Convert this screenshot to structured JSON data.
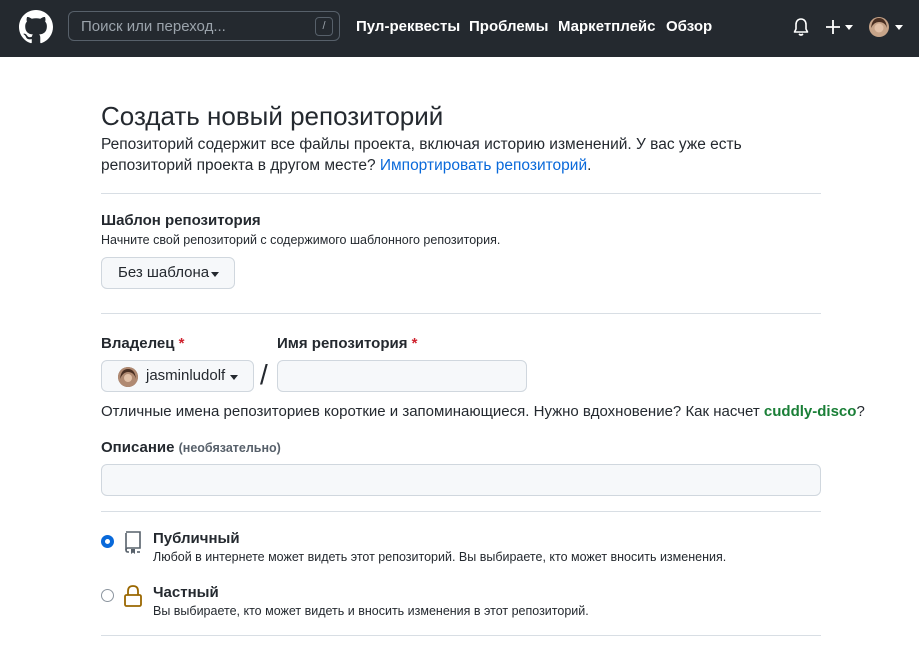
{
  "header": {
    "search_placeholder": "Поиск или переход...",
    "search_shortcut": "/",
    "nav": {
      "pulls": "Пул-реквесты",
      "issues": "Проблемы",
      "marketplace": "Маркетплейс",
      "explore": "Обзор"
    },
    "icons": [
      "github-logo-icon",
      "bell-icon",
      "plus-icon",
      "avatar"
    ]
  },
  "page": {
    "title": "Создать новый репозиторий",
    "lead_text": "Репозиторий содержит все файлы проекта, включая историю изменений. У вас уже есть репозиторий проекта в другом месте? ",
    "import_link": "Импортировать репозиторий",
    "lead_end": "."
  },
  "template": {
    "label": "Шаблон репозитория",
    "note": "Начните свой репозиторий с содержимого шаблонного репозитория.",
    "button": "Без шаблона"
  },
  "owner": {
    "label": "Владелец",
    "required_mark": "*",
    "value": "jasminludolf"
  },
  "repo_name": {
    "label": "Имя репозитория",
    "required_mark": "*",
    "value": "",
    "separator": "/"
  },
  "hint": {
    "text": "Отличные имена репозиториев короткие и запоминающиеся. Нужно вдохновение? Как насчет ",
    "suggestion": "cuddly-disco",
    "end": "?"
  },
  "description": {
    "label": "Описание",
    "optional": "(необязательно)",
    "value": ""
  },
  "visibility": {
    "options": [
      {
        "title": "Публичный",
        "desc": "Любой в интернете может видеть этот репозиторий. Вы выбираете, кто может вносить изменения.",
        "selected": true,
        "icon": "repo-icon"
      },
      {
        "title": "Частный",
        "desc": "Вы выбираете, кто может видеть и вносить изменения в этот репозиторий.",
        "selected": false,
        "icon": "lock-icon"
      }
    ]
  },
  "colors": {
    "header_bg": "#24292f",
    "link": "#0969da",
    "required": "#cf222e",
    "suggestion": "#1a7f37",
    "lock_icon": "#9a6700"
  }
}
